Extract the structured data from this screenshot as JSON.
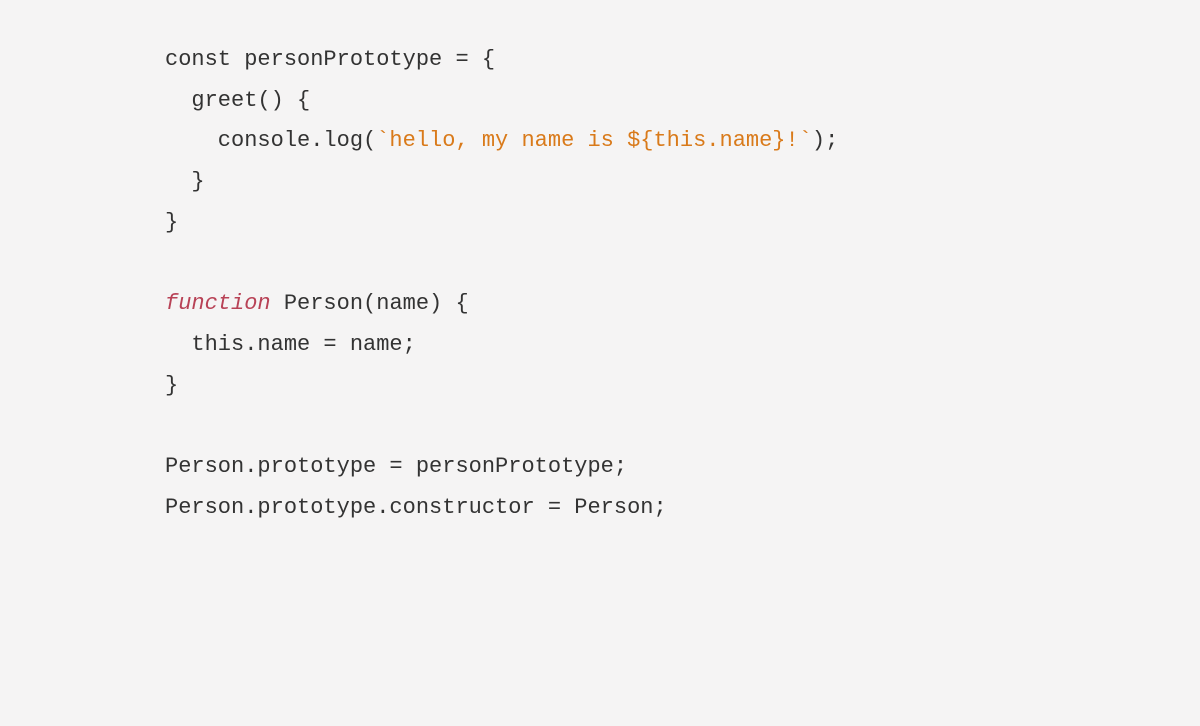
{
  "code": {
    "lines": [
      {
        "type": "plain",
        "content": "const personPrototype = {"
      },
      {
        "type": "plain",
        "content": "  greet() {"
      },
      {
        "type": "template",
        "prefix": "    console.log(",
        "template": "`hello, my name is ${this.name}!`",
        "suffix": ");"
      },
      {
        "type": "plain",
        "content": "  }"
      },
      {
        "type": "plain",
        "content": "}"
      },
      {
        "type": "plain",
        "content": ""
      },
      {
        "type": "function",
        "keyword": "function",
        "rest": " Person(name) {"
      },
      {
        "type": "plain",
        "content": "  this.name = name;"
      },
      {
        "type": "plain",
        "content": "}"
      },
      {
        "type": "plain",
        "content": ""
      },
      {
        "type": "plain",
        "content": "Person.prototype = personPrototype;"
      },
      {
        "type": "plain",
        "content": "Person.prototype.constructor = Person;"
      }
    ]
  }
}
